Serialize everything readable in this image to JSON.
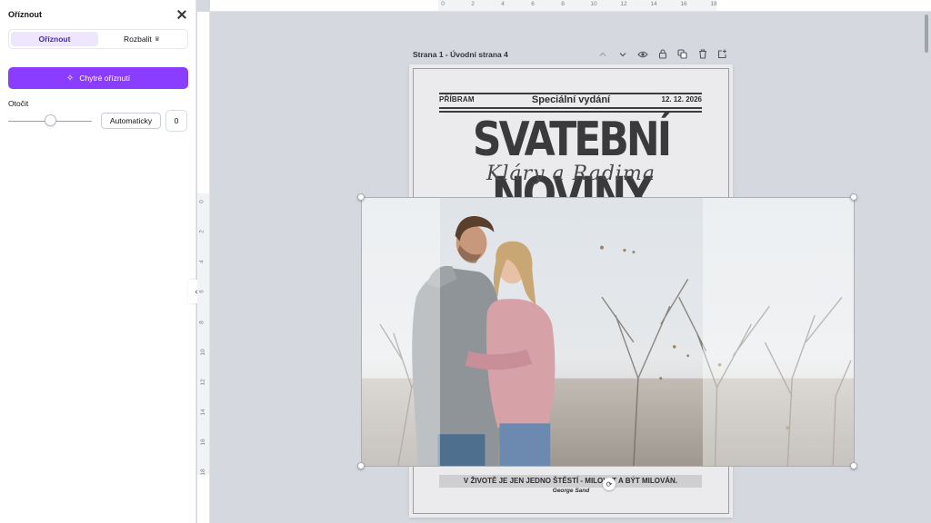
{
  "panel": {
    "title": "Oříznout",
    "tabs": [
      {
        "label": "Oříznout",
        "active": true
      },
      {
        "label": "Rozbalit",
        "badge_icon": "crown-icon"
      }
    ],
    "smart_crop_label": "Chytré oříznutí",
    "rotate_label": "Otočit",
    "rotate_slider_fraction": 0.5,
    "auto_label": "Automaticky",
    "rotate_value": "0"
  },
  "rulers": {
    "top": [
      "0",
      "2",
      "4",
      "6",
      "8",
      "10",
      "12",
      "14",
      "16",
      "18"
    ],
    "left": [
      "0",
      "2",
      "4",
      "6",
      "8",
      "10",
      "12",
      "14",
      "16",
      "18"
    ]
  },
  "page": {
    "caption": "Strana 1 - Úvodní strana 4",
    "toolbar_icons": [
      "chevron-up-icon",
      "chevron-down-icon",
      "eye-icon",
      "lock-icon",
      "duplicate-icon",
      "trash-icon",
      "add-page-icon"
    ]
  },
  "newspaper": {
    "place": "PŘÍBRAM",
    "special": "Speciální vydání",
    "date": "12. 12. 2026",
    "title": "SVATEBNÍ NOVINY",
    "names": "Kláry a Radima",
    "quote": "V ŽIVOTĚ JE JEN JEDNO ŠTĚSTÍ - MILOVAT A BÝT MILOVÁN.",
    "author": "George Sand"
  },
  "colors": {
    "accent": "#8b3dff",
    "accent_soft": "#ede6fc",
    "canvas_bg": "#d5d8df",
    "crop_border": "#b59cf0"
  }
}
